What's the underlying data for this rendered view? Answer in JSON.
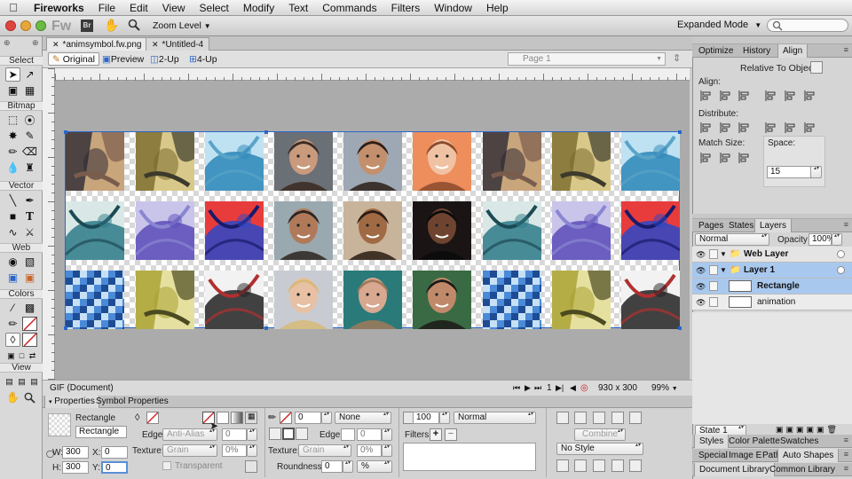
{
  "menubar": {
    "app_name": "Fireworks",
    "items": [
      "File",
      "Edit",
      "View",
      "Select",
      "Modify",
      "Text",
      "Commands",
      "Filters",
      "Window",
      "Help"
    ]
  },
  "app_toolbar": {
    "fw_logo": "Fw",
    "br_logo": "Br",
    "zoom_level_label": "Zoom Level",
    "workspace": "Expanded Mode"
  },
  "tools": {
    "sections": [
      "Select",
      "Bitmap",
      "Vector",
      "Web",
      "Colors",
      "View"
    ]
  },
  "document": {
    "tabs": [
      {
        "label": "*animsymbol.fw.png",
        "active": true
      },
      {
        "label": "*Untitled-4",
        "active": false
      }
    ],
    "views": [
      {
        "label": "Original",
        "active": true
      },
      {
        "label": "Preview",
        "active": false
      },
      {
        "label": "2-Up",
        "active": false
      },
      {
        "label": "4-Up",
        "active": false
      }
    ],
    "page_selector": "Page 1",
    "status_format": "GIF (Document)",
    "frame_number": "1",
    "canvas_size": "930 x 300",
    "zoom": "99%"
  },
  "canvas_tiles": [
    {
      "kind": "painting",
      "colors": [
        "#2d2a33",
        "#c9a57c",
        "#7a5c4c"
      ]
    },
    {
      "kind": "painting",
      "colors": [
        "#7a6a2c",
        "#d8c98a",
        "#3d3a2c"
      ]
    },
    {
      "kind": "abstract",
      "colors": [
        "#2c86b8",
        "#bfe2f2",
        "#5aa4c8"
      ]
    },
    {
      "kind": "portrait",
      "colors": [
        "#6b6f76",
        "#c99a7c",
        "#3a2a22"
      ]
    },
    {
      "kind": "portrait",
      "colors": [
        "#9da8b4",
        "#c48f6c",
        "#2b1e18"
      ]
    },
    {
      "kind": "portrait",
      "colors": [
        "#ee8e5c",
        "#f0c2a4",
        "#8a4a2c"
      ]
    },
    {
      "kind": "painting",
      "colors": [
        "#2d2a33",
        "#c9a57c",
        "#7a5c4c"
      ]
    },
    {
      "kind": "painting",
      "colors": [
        "#7a6a2c",
        "#d8c98a",
        "#3d3a2c"
      ]
    },
    {
      "kind": "abstract",
      "colors": [
        "#2c86b8",
        "#bfe2f2",
        "#5aa4c8"
      ]
    },
    {
      "kind": "abstract",
      "colors": [
        "#2d7a88",
        "#d9e8e6",
        "#1c4a54"
      ]
    },
    {
      "kind": "abstract",
      "colors": [
        "#5a4cb8",
        "#c9c4ea",
        "#8a86d2"
      ]
    },
    {
      "kind": "abstract",
      "colors": [
        "#2a48c8",
        "#e83c3c",
        "#1a1a6a"
      ]
    },
    {
      "kind": "portrait",
      "colors": [
        "#9aa8b0",
        "#b07a5a",
        "#2c2420"
      ]
    },
    {
      "kind": "portrait",
      "colors": [
        "#c8b49a",
        "#a06a44",
        "#2a1c14"
      ]
    },
    {
      "kind": "portrait",
      "colors": [
        "#1a1414",
        "#6e4430",
        "#0c0a0a"
      ]
    },
    {
      "kind": "abstract",
      "colors": [
        "#2d7a88",
        "#d9e8e6",
        "#1c4a54"
      ]
    },
    {
      "kind": "abstract",
      "colors": [
        "#5a4cb8",
        "#c9c4ea",
        "#8a86d2"
      ]
    },
    {
      "kind": "abstract",
      "colors": [
        "#2a48c8",
        "#e83c3c",
        "#1a1a6a"
      ]
    },
    {
      "kind": "pixel",
      "colors": [
        "#4a8ad8",
        "#c6e0f6",
        "#1e4c94"
      ]
    },
    {
      "kind": "painting",
      "colors": [
        "#a8a030",
        "#e6e0a0",
        "#4c4a20"
      ]
    },
    {
      "kind": "abstract",
      "colors": [
        "#222222",
        "#f2f2f2",
        "#b03030"
      ]
    },
    {
      "kind": "portrait",
      "colors": [
        "#c8ccd2",
        "#e8c0a4",
        "#d8b878"
      ]
    },
    {
      "kind": "portrait",
      "colors": [
        "#2a7a7a",
        "#d8a890",
        "#a07a5a"
      ]
    },
    {
      "kind": "portrait",
      "colors": [
        "#3a6a44",
        "#c08a6a",
        "#1c1a18"
      ]
    },
    {
      "kind": "pixel",
      "colors": [
        "#4a8ad8",
        "#c6e0f6",
        "#1e4c94"
      ]
    },
    {
      "kind": "painting",
      "colors": [
        "#a8a030",
        "#e6e0a0",
        "#4c4a20"
      ]
    },
    {
      "kind": "abstract",
      "colors": [
        "#222222",
        "#f2f2f2",
        "#b03030"
      ]
    }
  ],
  "properties": {
    "tabs": [
      "Properties",
      "Symbol Properties"
    ],
    "object_type": "Rectangle",
    "object_name": "Rectangle",
    "w": "300",
    "h": "300",
    "x": "0",
    "y": "0",
    "fill": {
      "edge_label": "Edge:",
      "edge_value": "Anti-Alias",
      "edge_amount": "0",
      "texture_label": "Texture:",
      "texture_value": "Grain",
      "texture_amount": "0%",
      "transparent_label": "Transparent"
    },
    "stroke": {
      "size": "0",
      "category": "None",
      "edge_label": "Edge:",
      "edge_amount": "0",
      "texture_label": "Texture:",
      "texture_value": "Grain",
      "texture_amount": "0%",
      "roundness_label": "Roundness:",
      "roundness_value": "0",
      "roundness_unit": "%"
    },
    "opacity": "100",
    "blend_mode": "Normal",
    "filters_label": "Filters:",
    "combine_label": "Combine",
    "style": "No Style"
  },
  "right_panel": {
    "top_tabs": [
      {
        "label": "Optimize",
        "active": false
      },
      {
        "label": "History",
        "active": false
      },
      {
        "label": "Align",
        "active": true
      }
    ],
    "relative_to": "Relative To Object",
    "align_label": "Align:",
    "distribute_label": "Distribute:",
    "match_size_label": "Match Size:",
    "space_label": "Space:",
    "space_value": "15",
    "layers_tabs": [
      {
        "label": "Pages",
        "active": false
      },
      {
        "label": "States",
        "active": false
      },
      {
        "label": "Layers",
        "active": true
      }
    ],
    "blend_mode": "Normal",
    "opacity_label": "Opacity",
    "opacity_value": "100%",
    "layers": [
      {
        "name": "Web Layer",
        "type": "layer",
        "bold": true,
        "selected": false
      },
      {
        "name": "Layer 1",
        "type": "layer",
        "bold": true,
        "selected": true
      },
      {
        "name": "Rectangle",
        "type": "object",
        "bold": true,
        "selected": true
      },
      {
        "name": "animation",
        "type": "object",
        "bold": false,
        "selected": false
      }
    ],
    "state_label": "State 1",
    "styles_tabs": [
      {
        "label": "Styles",
        "active": true
      },
      {
        "label": "Color Palette",
        "active": false
      },
      {
        "label": "Swatches",
        "active": false
      }
    ],
    "special_tabs": [
      {
        "label": "Special",
        "active": false
      },
      {
        "label": "Image E",
        "active": false
      },
      {
        "label": "Path",
        "active": false
      },
      {
        "label": "Auto Shapes",
        "active": true
      }
    ],
    "library_tabs": [
      {
        "label": "Document Library",
        "active": true
      },
      {
        "label": "Common Library",
        "active": false
      }
    ]
  },
  "colors": {
    "selection_blue": "#2a66c9",
    "layer_selected": "#a9c8ee",
    "stroke_red": "#d02020"
  }
}
